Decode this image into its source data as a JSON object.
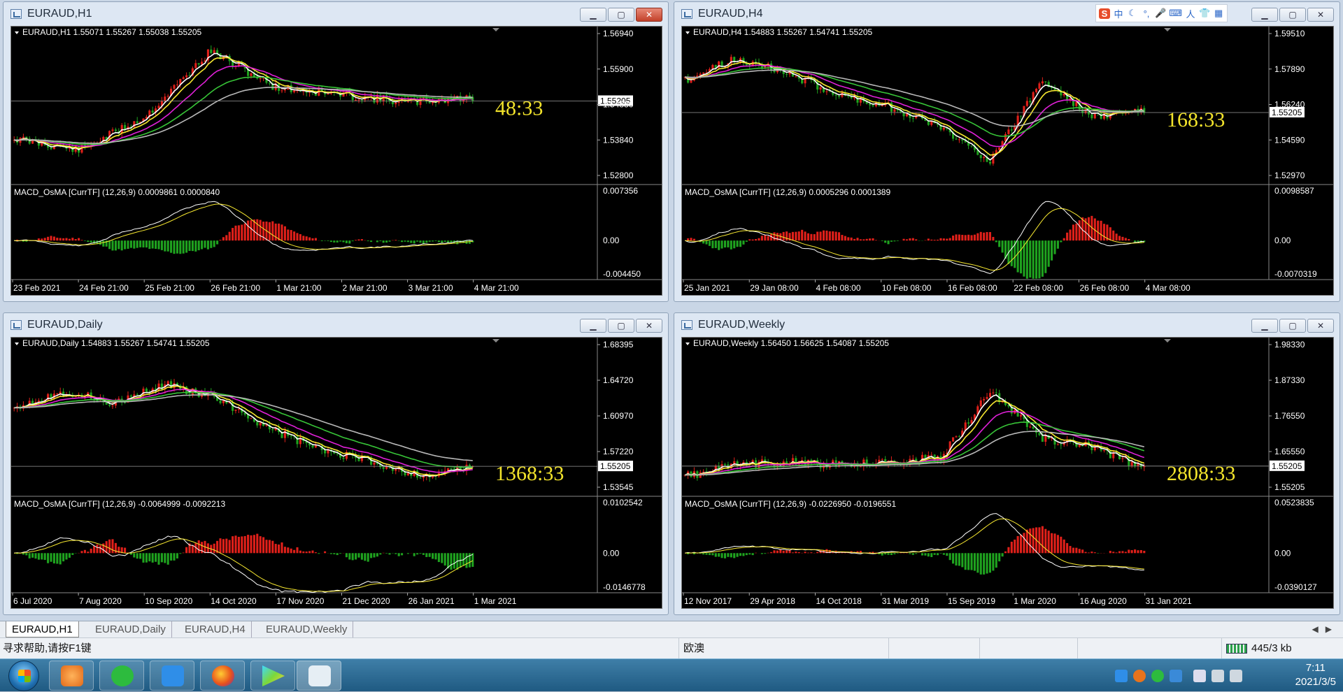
{
  "ime": {
    "items": [
      "S",
      "中",
      "☾",
      "°,",
      "🎤",
      "⌨",
      "人",
      "👕",
      "▦"
    ]
  },
  "windows": [
    {
      "title": "EURAUD,H1",
      "main_header": "EURAUD,H1  1.55071 1.55267 1.55038 1.55205",
      "sub_header": "MACD_OsMA [CurrTF] (12,26,9) 0.0009861 0.0000840",
      "timer": "48:33",
      "price_box": "1.55205",
      "price_axis": [
        "1.56940",
        "1.55900",
        "1.54880",
        "1.53840",
        "1.52800"
      ],
      "sub_axis": [
        "0.007356",
        "0.00",
        "-0.004450"
      ],
      "time_axis": [
        "23 Feb 2021",
        "24 Feb 21:00",
        "25 Feb 21:00",
        "26 Feb 21:00",
        "1 Mar 21:00",
        "2 Mar 21:00",
        "3 Mar 21:00",
        "4 Mar 21:00"
      ],
      "close_active": true,
      "seed": 11,
      "trend": [
        0.7,
        0.78,
        0.55,
        0.1,
        0.35,
        0.4,
        0.45,
        0.42
      ],
      "n": 150
    },
    {
      "title": "EURAUD,H4",
      "main_header": "EURAUD,H4  1.54883 1.55267 1.54741 1.55205",
      "sub_header": "MACD_OsMA [CurrTF] (12,26,9) 0.0005296 0.0001389",
      "timer": "168:33",
      "price_box": "1.55205",
      "price_axis": [
        "1.59510",
        "1.57890",
        "1.56240",
        "1.54590",
        "1.52970"
      ],
      "sub_axis": [
        "0.0098587",
        "0.00",
        "-0.0070319"
      ],
      "time_axis": [
        "25 Jan 2021",
        "29 Jan 08:00",
        "4 Feb 08:00",
        "10 Feb 08:00",
        "16 Feb 08:00",
        "22 Feb 08:00",
        "26 Feb 08:00",
        "4 Mar 08:00"
      ],
      "close_active": false,
      "seed": 23,
      "trend": [
        0.3,
        0.15,
        0.25,
        0.4,
        0.48,
        0.62,
        0.85,
        0.3,
        0.55,
        0.5
      ],
      "n": 150
    },
    {
      "title": "EURAUD,Daily",
      "main_header": "EURAUD,Daily  1.54883 1.55267 1.54741 1.55205",
      "sub_header": "MACD_OsMA [CurrTF] (12,26,9) -0.0064999 -0.0092213",
      "timer": "1368:33",
      "price_box": "1.55205",
      "price_axis": [
        "1.68395",
        "1.64720",
        "1.60970",
        "1.57220",
        "1.53545"
      ],
      "sub_axis": [
        "0.0102542",
        "0.00",
        "-0.0146778"
      ],
      "time_axis": [
        "6 Jul 2020",
        "7 Aug 2020",
        "10 Sep 2020",
        "14 Oct 2020",
        "17 Nov 2020",
        "21 Dec 2020",
        "26 Jan 2021",
        "1 Mar 2021"
      ],
      "close_active": false,
      "seed": 37,
      "trend": [
        0.4,
        0.3,
        0.38,
        0.25,
        0.35,
        0.55,
        0.7,
        0.78,
        0.88,
        0.82
      ],
      "n": 150
    },
    {
      "title": "EURAUD,Weekly",
      "main_header": "EURAUD,Weekly  1.56450 1.56625 1.54087 1.55205",
      "sub_header": "MACD_OsMA [CurrTF] (12,26,9) -0.0226950 -0.0196551",
      "timer": "2808:33",
      "price_box": "1.55205",
      "price_axis": [
        "1.98330",
        "1.87330",
        "1.76550",
        "1.65550",
        "1.55205"
      ],
      "sub_axis": [
        "0.0523835",
        "0.00",
        "-0.0390127"
      ],
      "time_axis": [
        "12 Nov 2017",
        "29 Apr 2018",
        "14 Oct 2018",
        "31 Mar 2019",
        "15 Sep 2019",
        "1 Mar 2020",
        "16 Aug 2020",
        "31 Jan 2021"
      ],
      "close_active": false,
      "seed": 53,
      "trend": [
        0.88,
        0.8,
        0.78,
        0.8,
        0.78,
        0.75,
        0.3,
        0.62,
        0.68,
        0.82
      ],
      "n": 150
    }
  ],
  "tabs": [
    "EURAUD,H1",
    "EURAUD,Daily",
    "EURAUD,H4",
    "EURAUD,Weekly"
  ],
  "status": {
    "help": "寻求帮助,请按F1键",
    "profile": "欧澳",
    "traffic": "445/3 kb"
  },
  "clock": {
    "time": "7:11",
    "date": "2021/3/5"
  },
  "colors": {
    "bull": "#e0201a",
    "bear": "#1fa31f",
    "ma_white": "#ffffff",
    "ma_yellow": "#f7e830",
    "ma_magenta": "#e020d8",
    "ma_green": "#37c437",
    "ma_gray": "#b8b8b8",
    "timer": "#f2e32b"
  }
}
